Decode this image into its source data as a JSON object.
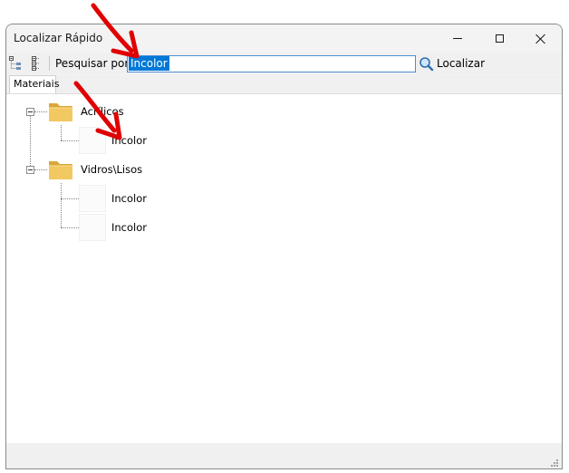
{
  "window": {
    "title": "Localizar Rápido"
  },
  "toolbar": {
    "search_label": "Pesquisar por:",
    "search_value": "Incolor",
    "find_label": "Localizar"
  },
  "tabs": [
    {
      "label": "Materiais"
    }
  ],
  "tree": {
    "groups": [
      {
        "label": "Acrílicos",
        "children": [
          "Incolor"
        ]
      },
      {
        "label": "Vidros\\Lisos",
        "children": [
          "Incolor",
          "Incolor"
        ]
      }
    ]
  },
  "colors": {
    "selection": "#0078d7",
    "input_border": "#4a8fd6",
    "annotation_arrow": "#e00000",
    "folder": "#e8b84a"
  },
  "icons": {
    "expand_all": "tree-expand-icon",
    "collapse_all": "tree-collapse-icon",
    "find": "magnifier-icon",
    "folder": "folder-icon",
    "grip": "resize-grip-icon"
  }
}
